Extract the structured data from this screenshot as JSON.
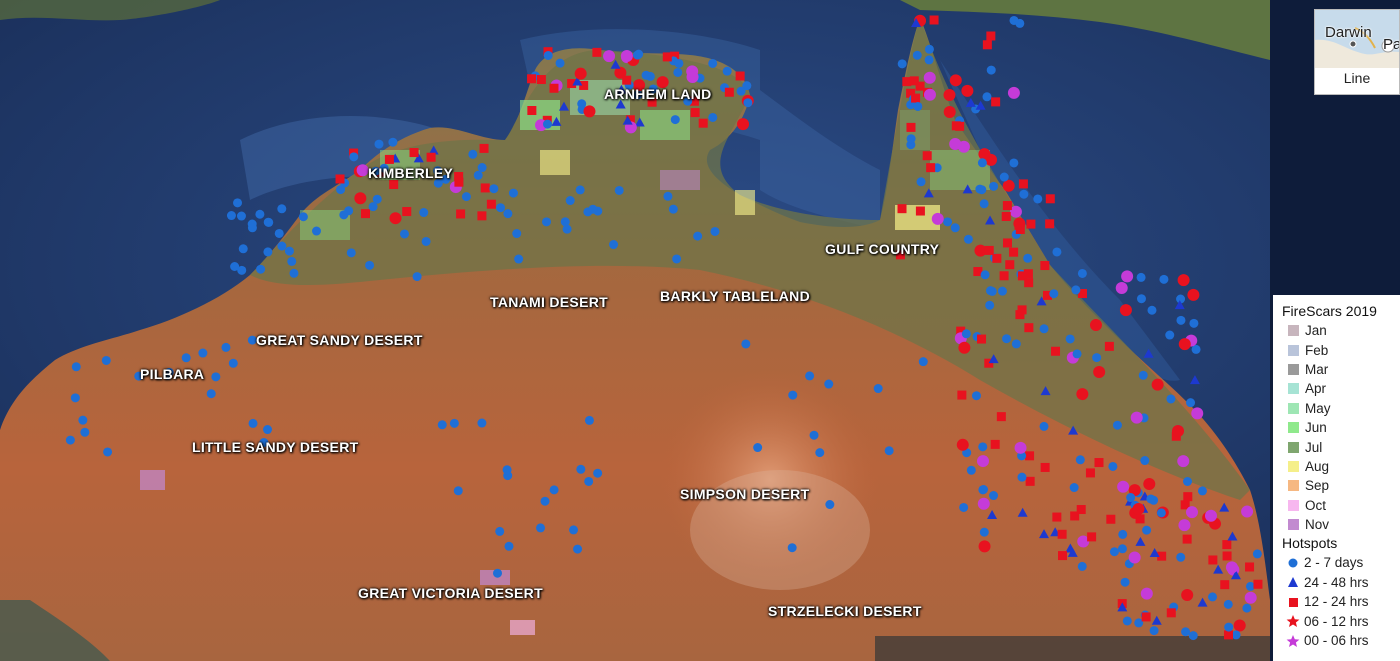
{
  "regions": [
    {
      "label": "ARNHEM LAND",
      "id": "arnhem-land"
    },
    {
      "label": "KIMBERLEY",
      "id": "kimberley"
    },
    {
      "label": "GULF COUNTRY",
      "id": "gulf-country"
    },
    {
      "label": "TANAMI DESERT",
      "id": "tanami-desert"
    },
    {
      "label": "BARKLY TABLELAND",
      "id": "barkly-tableland"
    },
    {
      "label": "GREAT SANDY DESERT",
      "id": "great-sandy-desert"
    },
    {
      "label": "PILBARA",
      "id": "pilbara"
    },
    {
      "label": "LITTLE SANDY DESERT",
      "id": "little-sandy-desert"
    },
    {
      "label": "SIMPSON DESERT",
      "id": "simpson-desert"
    },
    {
      "label": "GREAT VICTORIA DESERT",
      "id": "great-victoria-desert"
    },
    {
      "label": "STRZELECKI DESERT",
      "id": "strzelecki-desert"
    }
  ],
  "map_type_control": {
    "city": "Darwin",
    "city_partial": "Pa",
    "caption": "Line"
  },
  "legend": {
    "firescars_title": "FireScars 2019",
    "months": [
      {
        "label": "Jan",
        "color": "#c7b5bd"
      },
      {
        "label": "Feb",
        "color": "#b9c4da"
      },
      {
        "label": "Mar",
        "color": "#9a9a9a"
      },
      {
        "label": "Apr",
        "color": "#a6e3d4"
      },
      {
        "label": "May",
        "color": "#9ee6b4"
      },
      {
        "label": "Jun",
        "color": "#8fe98c"
      },
      {
        "label": "Jul",
        "color": "#7fa66f"
      },
      {
        "label": "Aug",
        "color": "#f5ef8a"
      },
      {
        "label": "Sep",
        "color": "#f6b882"
      },
      {
        "label": "Oct",
        "color": "#f7b7ef"
      },
      {
        "label": "Nov",
        "color": "#c28ad0"
      }
    ],
    "hotspots_title": "Hotspots",
    "hotspots": [
      {
        "label": "2 - 7 days",
        "symbol": "circle",
        "color": "#1f6fd6"
      },
      {
        "label": "24 - 48 hrs",
        "symbol": "triangle",
        "color": "#1d39d0"
      },
      {
        "label": "12 - 24 hrs",
        "symbol": "square",
        "color": "#e8121f"
      },
      {
        "label": "06 - 12 hrs",
        "symbol": "star",
        "color": "#e8121f"
      },
      {
        "label": "00 - 06 hrs",
        "symbol": "star",
        "color": "#c53bd8"
      }
    ]
  }
}
